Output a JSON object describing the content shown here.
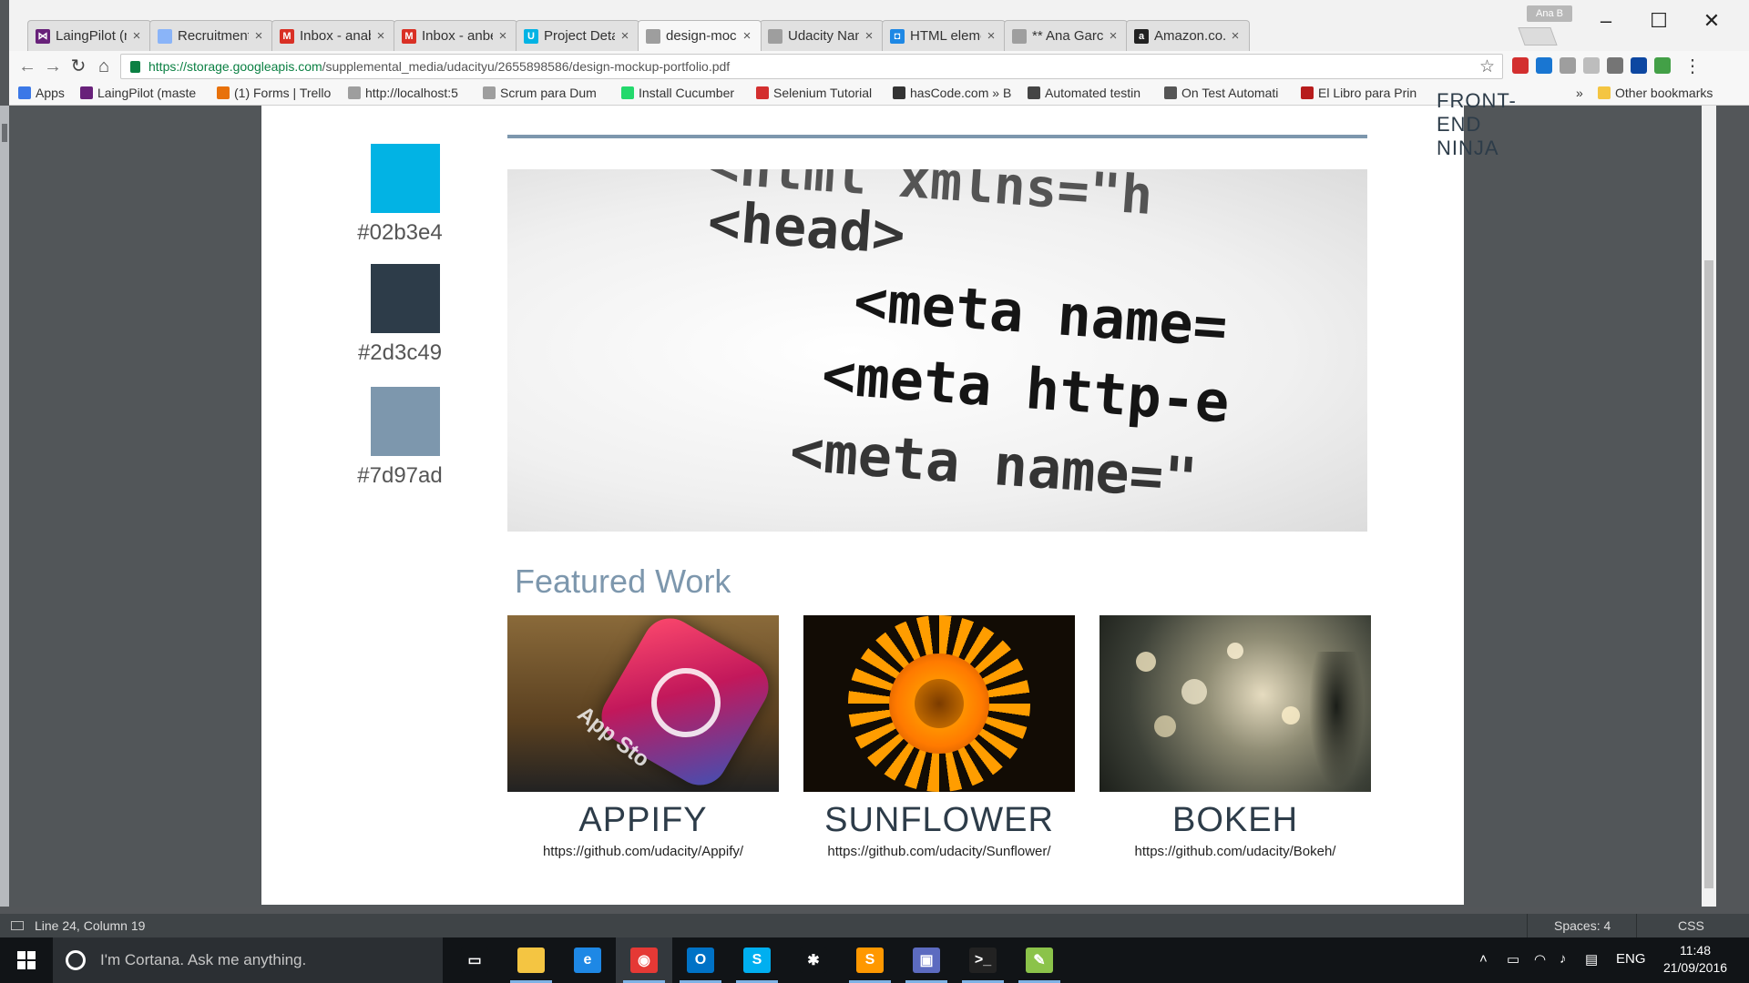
{
  "profile_name": "Ana B",
  "tabs": [
    {
      "label": "LaingPilot (mas",
      "icon": "visual-studio-icon",
      "color": "#68217a",
      "glyph": "⋈"
    },
    {
      "label": "Recruitment Ca",
      "icon": "document-icon",
      "color": "#8ab4f8",
      "glyph": ""
    },
    {
      "label": "Inbox - anab.ga",
      "icon": "gmail-icon",
      "color": "#d93025",
      "glyph": "M"
    },
    {
      "label": "Inbox - anbega",
      "icon": "gmail-icon",
      "color": "#d93025",
      "glyph": "M"
    },
    {
      "label": "Project Details",
      "icon": "udacity-icon",
      "color": "#02b3e4",
      "glyph": "U"
    },
    {
      "label": "design-mockup",
      "icon": "document-icon",
      "color": "#9e9e9e",
      "glyph": ""
    },
    {
      "label": "Udacity Nanod",
      "icon": "document-icon",
      "color": "#9e9e9e",
      "glyph": ""
    },
    {
      "label": "HTML element",
      "icon": "mdn-icon",
      "color": "#1e88e5",
      "glyph": "◘"
    },
    {
      "label": "** Ana Garcia",
      "icon": "document-icon",
      "color": "#9e9e9e",
      "glyph": ""
    },
    {
      "label": "Amazon.co.uk",
      "icon": "amazon-icon",
      "color": "#222222",
      "glyph": "a"
    }
  ],
  "active_tab_index": 5,
  "address_bar": {
    "domain": "https://storage.googleapis.com",
    "path": "/supplemental_media/udacityu/2655898586/design-mockup-portfolio.pdf"
  },
  "bookmarks": [
    {
      "label": "Apps",
      "icon": "apps-grid-icon",
      "color": "#3b78e7"
    },
    {
      "label": "LaingPilot (maste",
      "icon": "visual-studio-icon",
      "color": "#68217a"
    },
    {
      "label": "(1) Forms | Trello",
      "icon": "trello-icon",
      "color": "#e8710a"
    },
    {
      "label": "http://localhost:5",
      "icon": "page-icon",
      "color": "#9e9e9e"
    },
    {
      "label": "Scrum para Dum",
      "icon": "page-icon",
      "color": "#9e9e9e"
    },
    {
      "label": "Install Cucumber",
      "icon": "cucumber-icon",
      "color": "#23d96c"
    },
    {
      "label": "Selenium Tutorial",
      "icon": "selenium-icon",
      "color": "#d32f2f"
    },
    {
      "label": "hasCode.com » B",
      "icon": "hascode-icon",
      "color": "#333333"
    },
    {
      "label": "Automated testin",
      "icon": "network-icon",
      "color": "#444444"
    },
    {
      "label": "On Test Automati",
      "icon": "gears-icon",
      "color": "#555555"
    },
    {
      "label": "El Libro para Prin",
      "icon": "netflix-icon",
      "color": "#b71c1c"
    }
  ],
  "bookmarks_overflow": "»",
  "other_bookmarks": "Other bookmarks",
  "document": {
    "clipped_heading": "FRONT-END NINJA",
    "palette": [
      {
        "hex": "#02b3e4"
      },
      {
        "hex": "#2d3c49"
      },
      {
        "hex": "#7d97ad"
      }
    ],
    "hero_code_lines": [
      "<html   xmlns=\"h",
      "<head>",
      "<meta  name=",
      "<meta  http-e",
      "<meta  name=\""
    ],
    "featured_title": "Featured Work",
    "works": [
      {
        "title": "APPIFY",
        "link": "https://github.com/udacity/Appify/",
        "thumb_icon": "app-store-icon"
      },
      {
        "title": "SUNFLOWER",
        "link": "https://github.com/udacity/Sunflower/",
        "thumb_icon": "sunflower-image"
      },
      {
        "title": "BOKEH",
        "link": "https://github.com/udacity/Bokeh/",
        "thumb_icon": "bokeh-image"
      }
    ]
  },
  "editor_status": {
    "position": "Line 24, Column 19",
    "spaces": "Spaces: 4",
    "syntax": "CSS"
  },
  "taskbar": {
    "cortana_placeholder": "I'm Cortana. Ask me anything.",
    "apps": [
      {
        "name": "task-view",
        "color": "#111417",
        "glyph": "▭"
      },
      {
        "name": "file-explorer",
        "color": "#f4c542",
        "glyph": ""
      },
      {
        "name": "edge",
        "color": "#1e88e5",
        "glyph": "e"
      },
      {
        "name": "chrome",
        "color": "#e53935",
        "glyph": "◉"
      },
      {
        "name": "outlook",
        "color": "#0072c6",
        "glyph": "O"
      },
      {
        "name": "skype",
        "color": "#00aff0",
        "glyph": "S"
      },
      {
        "name": "slack",
        "color": "#111417",
        "glyph": "✱"
      },
      {
        "name": "sublime-text",
        "color": "#ff9800",
        "glyph": "S"
      },
      {
        "name": "network-tool",
        "color": "#5c6bc0",
        "glyph": "▣"
      },
      {
        "name": "command-prompt",
        "color": "#222222",
        "glyph": ">_"
      },
      {
        "name": "notepad-plus",
        "color": "#8bc34a",
        "glyph": "✎"
      }
    ],
    "language": "ENG",
    "time": "11:48",
    "date": "21/09/2016"
  }
}
